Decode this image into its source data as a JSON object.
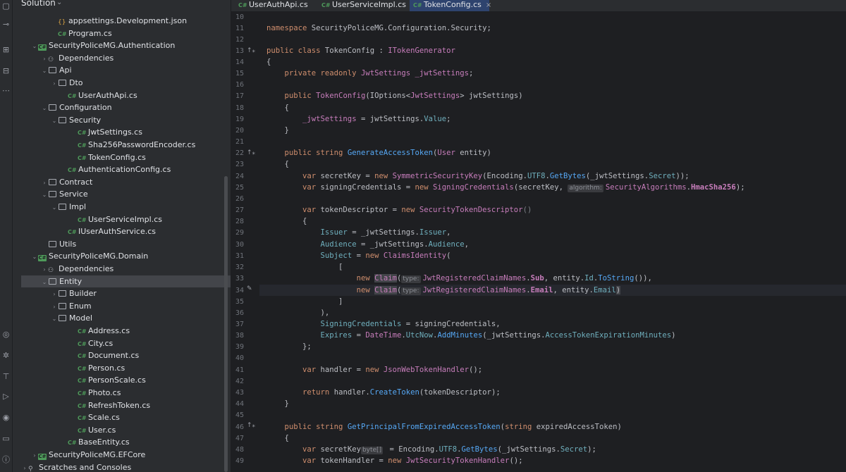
{
  "sidebar": {
    "title": "Solution",
    "rows": [
      {
        "label": "appsettings.Development.json",
        "kind": "json",
        "depth": 3
      },
      {
        "label": "Program.cs",
        "kind": "cs",
        "depth": 3
      },
      {
        "label": "SecurityPoliceMG.Authentication",
        "kind": "project",
        "depth": 1,
        "arrow": "v"
      },
      {
        "label": "Dependencies",
        "kind": "deps",
        "depth": 2,
        "arrow": ">"
      },
      {
        "label": "Api",
        "kind": "folder",
        "depth": 2,
        "arrow": "v"
      },
      {
        "label": "Dto",
        "kind": "folder",
        "depth": 3,
        "arrow": ">"
      },
      {
        "label": "UserAuthApi.cs",
        "kind": "cs",
        "depth": 4
      },
      {
        "label": "Configuration",
        "kind": "folder",
        "depth": 2,
        "arrow": "v"
      },
      {
        "label": "Security",
        "kind": "folder",
        "depth": 3,
        "arrow": "v"
      },
      {
        "label": "JwtSettings.cs",
        "kind": "cs",
        "depth": 5
      },
      {
        "label": "Sha256PasswordEncoder.cs",
        "kind": "cs",
        "depth": 5
      },
      {
        "label": "TokenConfig.cs",
        "kind": "cs",
        "depth": 5
      },
      {
        "label": "AuthenticationConfig.cs",
        "kind": "cs",
        "depth": 4
      },
      {
        "label": "Contract",
        "kind": "folder",
        "depth": 2,
        "arrow": ">"
      },
      {
        "label": "Service",
        "kind": "folder",
        "depth": 2,
        "arrow": "v"
      },
      {
        "label": "Impl",
        "kind": "folder",
        "depth": 3,
        "arrow": "v"
      },
      {
        "label": "UserServiceImpl.cs",
        "kind": "cs",
        "depth": 5
      },
      {
        "label": "IUserAuthService.cs",
        "kind": "cs",
        "depth": 4
      },
      {
        "label": "Utils",
        "kind": "folder",
        "depth": 2
      },
      {
        "label": "SecurityPoliceMG.Domain",
        "kind": "project",
        "depth": 1,
        "arrow": "v"
      },
      {
        "label": "Dependencies",
        "kind": "deps",
        "depth": 2,
        "arrow": ">"
      },
      {
        "label": "Entity",
        "kind": "folder",
        "depth": 2,
        "arrow": "v",
        "selected": true
      },
      {
        "label": "Builder",
        "kind": "folder",
        "depth": 3,
        "arrow": ">"
      },
      {
        "label": "Enum",
        "kind": "folder",
        "depth": 3,
        "arrow": ">"
      },
      {
        "label": "Model",
        "kind": "folder",
        "depth": 3,
        "arrow": "v"
      },
      {
        "label": "Address.cs",
        "kind": "cs",
        "depth": 5
      },
      {
        "label": "City.cs",
        "kind": "cs",
        "depth": 5
      },
      {
        "label": "Document.cs",
        "kind": "cs",
        "depth": 5
      },
      {
        "label": "Person.cs",
        "kind": "cs",
        "depth": 5
      },
      {
        "label": "PersonScale.cs",
        "kind": "cs",
        "depth": 5
      },
      {
        "label": "Photo.cs",
        "kind": "cs",
        "depth": 5
      },
      {
        "label": "RefreshToken.cs",
        "kind": "cs",
        "depth": 5
      },
      {
        "label": "Scale.cs",
        "kind": "cs",
        "depth": 5
      },
      {
        "label": "User.cs",
        "kind": "cs",
        "depth": 5
      },
      {
        "label": "BaseEntity.cs",
        "kind": "cs",
        "depth": 4
      },
      {
        "label": "SecurityPoliceMG.EFCore",
        "kind": "project",
        "depth": 1,
        "arrow": ">"
      },
      {
        "label": "Scratches and Consoles",
        "kind": "scratch",
        "depth": 0,
        "arrow": ">"
      }
    ]
  },
  "tabs": [
    {
      "label": "UserAuthApi.cs",
      "badge": "C#"
    },
    {
      "label": "UserServiceImpl.cs",
      "badge": "C#"
    },
    {
      "label": "TokenConfig.cs",
      "badge": "C#",
      "active": true
    }
  ],
  "gutter": [
    "10",
    "11",
    "12",
    "13",
    "14",
    "15",
    "16",
    "17",
    "18",
    "19",
    "20",
    "21",
    "22",
    "23",
    "24",
    "25",
    "26",
    "27",
    "28",
    "29",
    "30",
    "31",
    "32",
    "33",
    "34",
    "35",
    "36",
    "37",
    "38",
    "39",
    "40",
    "41",
    "42",
    "43",
    "44",
    "45",
    "46",
    "47",
    "48",
    "49"
  ],
  "code": {
    "l11_ns": "namespace SecurityPoliceMG.Configuration.Security;",
    "l13_a": "public class ",
    "l13_b": "TokenConfig",
    ": ": " : ",
    "l13_c": "ITokenGenerator",
    "l14": "{",
    "l15_a": "private readonly ",
    "l15_b": "JwtSettings ",
    "l15_c": "_jwtSettings",
    ";": ";",
    "l17_a": "public ",
    "l17_b": "TokenConfig",
    "l17_c": "(IOptions<",
    "l17_d": "JwtSettings",
    "l17_e": "> jwtSettings)",
    "l18": "{",
    "l19_a": "_jwtSettings",
    " = ": " = ",
    "l19_b": "Value",
    "l20": "}",
    "l22_a": "public string ",
    "l22_b": "GenerateAccessToken",
    "l22_c": "(",
    "l22_d": "User",
    " entity": " entity)",
    "l23": "{",
    "l24_a": "var ",
    "l24_b": "secretKey = ",
    "l24_c": "new ",
    "l24_d": "SymmetricSecurityKey",
    "l24_e": "(Encoding.",
    "l24_f": "UTF8",
    ".": ".",
    "l24_g": "GetBytes",
    "l24_h": "(_jwtSettings.",
    "l24_i": "Secret",
    "l24_j": "));",
    "l25_a": "var ",
    "l25_b": "signingCredentials = ",
    "l25_c": "new ",
    "l25_d": "SigningCredentials",
    "l25_e": "(secretKey, ",
    "l25_hint": "algorithm:",
    "l25_f": "SecurityAlgorithms.",
    "l25_g": "HmacSha256",
    "l25_h": ");",
    "l27_a": "var ",
    "l27_b": "tokenDescriptor = ",
    "l27_c": "new ",
    "l27_d": "SecurityTokenDescriptor",
    "l27_e": "()",
    "l28": "{",
    "l29_a": "Issuer",
    " = _jwtSettings.": " = _jwtSettings.",
    "l29_b": "Issuer",
    ",": ",",
    "l30_a": "Audience",
    "l30_b": "Audience",
    "l31_a": "Subject",
    " = new ": " = ",
    "l31_b": "new ",
    "l31_c": "ClaimsIdentity",
    "l31_d": "(",
    "l32": "[",
    "l33_a": "new ",
    "l33_b": "Claim",
    "l33_c": "(",
    "l33_hint": "type:",
    "l33_d": "JwtRegisteredClaimNames.",
    "l33_e": "Sub",
    "l33_f": ", entity.",
    "l33_g": "Id",
    "l33_h": "ToString",
    "l33_i": "()),",
    "l34_a": "new ",
    "l34_b": "Claim",
    "l34_c": "(",
    "l34_hint": "type:",
    "l34_d": "JwtRegisteredClaimNames.",
    "l34_e": "Email",
    "l34_f": ", entity.",
    "l34_g": "Email",
    "l34_h": ")",
    "l35": "]",
    "l36": "),",
    "l37_a": "SigningCredentials",
    "l37_b": " = signingCredentials,",
    "l38_a": "Expires",
    "l38_b": "DateTime",
    "l38_c": "UtcNow",
    "l38_d": "AddMinutes",
    "l38_e": "(_jwtSettings.",
    "l38_f": "AccessTokenExpirationMinutes",
    "l38_g": ")",
    "l39": "};",
    "l41_a": "var ",
    "l41_b": "handler = ",
    "l41_c": "new ",
    "l41_d": "JsonWebTokenHandler",
    "l41_e": "();",
    "l43_a": "return ",
    "l43_b": "handler.",
    "l43_c": "CreateToken",
    "l43_d": "(tokenDescriptor);",
    "l44": "}",
    "l46_a": "public string ",
    "l46_b": "GetPrincipalFromExpiredAccessToken",
    "l46_c": "(",
    "l46_d": "string ",
    "l46_e": "expiredAccessToken)",
    "l47": "{",
    "l48_a": "var ",
    "l48_b": "secretKey",
    "l48_hint": "byte[]",
    "l48_c": " = Encoding.",
    "l48_d": "UTF8",
    "l48_e": "GetBytes",
    "l48_f": "(_jwtSettings.",
    "l48_g": "Secret",
    "l48_h": ");",
    "l49_a": "var ",
    "l49_b": "tokenHandler = ",
    "l49_c": "new ",
    "l49_d": "JwtSecurityTokenHandler",
    "l49_e": "();"
  },
  "colors": {
    "bg": "#1e1f22",
    "panel": "#2b2d30",
    "keyword": "#cf8e6d",
    "type": "#c77dbb",
    "method": "#56a8f5",
    "property": "#6fafbd",
    "active_tab": "#2e436e"
  }
}
